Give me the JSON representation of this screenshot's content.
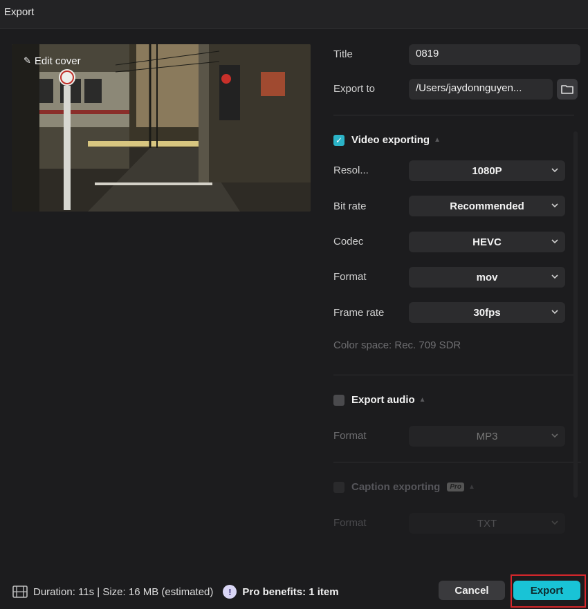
{
  "window": {
    "title": "Export"
  },
  "preview": {
    "edit_cover_label": "Edit cover"
  },
  "form": {
    "title_label": "Title",
    "title_value": "0819",
    "export_to_label": "Export to",
    "export_to_value": "/Users/jaydonnguyen..."
  },
  "video": {
    "section_label": "Video exporting",
    "checked": true,
    "resolution_label": "Resol...",
    "resolution_value": "1080P",
    "bitrate_label": "Bit rate",
    "bitrate_value": "Recommended",
    "codec_label": "Codec",
    "codec_value": "HEVC",
    "format_label": "Format",
    "format_value": "mov",
    "framerate_label": "Frame rate",
    "framerate_value": "30fps",
    "color_space": "Color space: Rec. 709 SDR"
  },
  "audio": {
    "section_label": "Export audio",
    "checked": false,
    "format_label": "Format",
    "format_value": "MP3"
  },
  "caption": {
    "section_label": "Caption exporting",
    "pro_badge": "Pro",
    "format_label": "Format",
    "format_value": "TXT"
  },
  "footer": {
    "summary": "Duration: 11s | Size: 16 MB (estimated)",
    "pro_benefits": "Pro benefits: 1 item",
    "cancel_label": "Cancel",
    "export_label": "Export"
  },
  "colors": {
    "accent": "#19c3d6",
    "highlight_frame": "#d6262b",
    "background": "#1c1c1e"
  }
}
